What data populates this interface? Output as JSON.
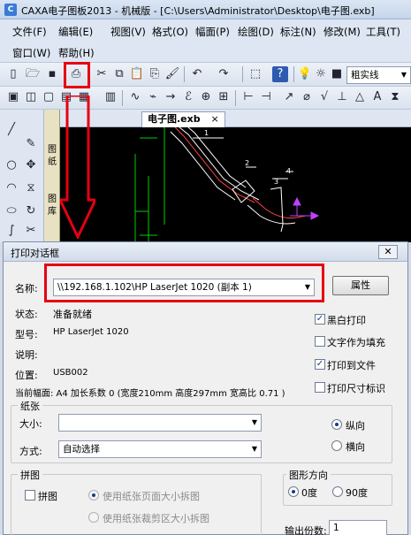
{
  "window": {
    "title": "CAXA电子图板2013 - 机械版 - [C:\\Users\\Administrator\\Desktop\\电子图.exb]"
  },
  "menu": {
    "row1": [
      "文件(F)",
      "编辑(E)",
      "视图(V)",
      "格式(O)",
      "幅面(P)",
      "绘图(D)",
      "标注(N)",
      "修改(M)",
      "工具(T)"
    ],
    "row2": [
      "窗口(W)",
      "帮助(H)"
    ]
  },
  "toolbar": {
    "font_name": "粗实线"
  },
  "side_tab": {
    "chars": [
      "图",
      "纸",
      "",
      "图",
      "库"
    ]
  },
  "document": {
    "tab_label": "电子图.exb",
    "close": "×",
    "dimension_labels": [
      "1",
      "2",
      "3",
      "4"
    ]
  },
  "dialog": {
    "title": "打印对话框",
    "close": "✕",
    "name_label": "名称:",
    "printer_name": "\\\\192.168.1.102\\HP LaserJet 1020 (副本 1)",
    "properties_button": "属性",
    "status_label": "状态:",
    "status_value": "准备就绪",
    "model_label": "型号:",
    "model_value": "HP LaserJet 1020",
    "desc_label": "说明:",
    "location_label": "位置:",
    "location_value": "USB002",
    "current_sheet": "当前幅面:  A4  加长系数 0   (宽度210mm  高度297mm  宽高比 0.71 )",
    "options": [
      {
        "label": "黑白打印",
        "checked": true
      },
      {
        "label": "文字作为填充",
        "checked": false
      },
      {
        "label": "打印到文件",
        "checked": true
      },
      {
        "label": "打印尺寸标识",
        "checked": false
      }
    ],
    "paper": {
      "group_title": "纸张",
      "size_label": "大小:",
      "size_value": "",
      "source_label": "方式:",
      "source_value": "自动选择",
      "portrait_label": "纵向",
      "landscape_label": "横向",
      "orientation": "portrait"
    },
    "tiling": {
      "group_title": "拼图",
      "tile_label": "拼图",
      "tile_checked": false,
      "option1": "使用纸张页面大小拆图",
      "option2": "使用纸张裁剪区大小拆图"
    },
    "direction": {
      "group_title": "图形方向",
      "deg0": "0度",
      "deg90": "90度",
      "selected": "0"
    },
    "copies": {
      "label": "输出份数:",
      "value": "1"
    }
  },
  "colors": {
    "highlight": "#e60012",
    "canvas_bg": "#000000"
  }
}
